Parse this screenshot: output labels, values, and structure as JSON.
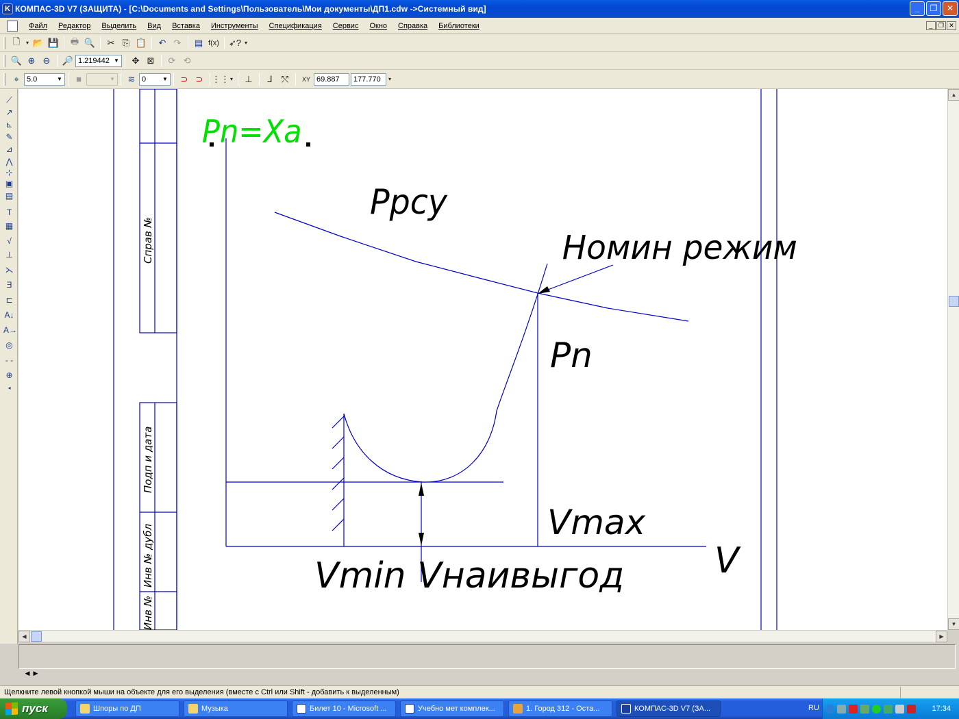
{
  "window": {
    "title": "КОМПАС-3D V7 (ЗАЩИТА) - [C:\\Documents and Settings\\Пользователь\\Мои документы\\ДП1.cdw ->Системный вид]",
    "minimize": "_",
    "maximize": "❐",
    "close": "✕"
  },
  "menu": {
    "items": [
      "Файл",
      "Редактор",
      "Выделить",
      "Вид",
      "Вставка",
      "Инструменты",
      "Спецификация",
      "Сервис",
      "Окно",
      "Справка",
      "Библиотеки"
    ]
  },
  "toolbar_view": {
    "zoom_value": "1.219442"
  },
  "toolbar_params": {
    "step_value": "5.0",
    "layer_value": "0",
    "coord_label": "Y",
    "coord_x": "69.887",
    "coord_y": "177.770"
  },
  "drawing": {
    "title_label": "Pn=Xa",
    "curve_label_top": "Ppcy",
    "arrow_label": "Номин режим",
    "pn_label": "Pn",
    "vmax_label": "Vmax",
    "v_axis_label": "V",
    "bottom_label": "Vmin Vнаивыгод",
    "frame_label_1": "Справ №",
    "frame_label_2": "Подп и дата",
    "frame_label_3": "Инв № дубл",
    "frame_label_4": "Инв №",
    "line_color": "#0000c8",
    "title_color": "#00e000"
  },
  "status": {
    "hint": "Щелкните левой кнопкой мыши на объекте для его выделения (вместе с Ctrl или Shift - добавить к выделенным)"
  },
  "taskbar": {
    "start_label": "пуск",
    "tasks": [
      {
        "label": "Шпоры по ДП",
        "icon": "folder-icon"
      },
      {
        "label": "Музыка",
        "icon": "folder-icon"
      },
      {
        "label": "Билет 10 - Microsoft ...",
        "icon": "word-icon"
      },
      {
        "label": "Учебно мет комплек...",
        "icon": "word-icon"
      },
      {
        "label": "1. Город 312 - Оста...",
        "icon": "player-icon"
      },
      {
        "label": "КОМПАС-3D V7 (ЗА...",
        "icon": "kompas-icon"
      }
    ],
    "language": "RU",
    "clock": "17:34"
  }
}
